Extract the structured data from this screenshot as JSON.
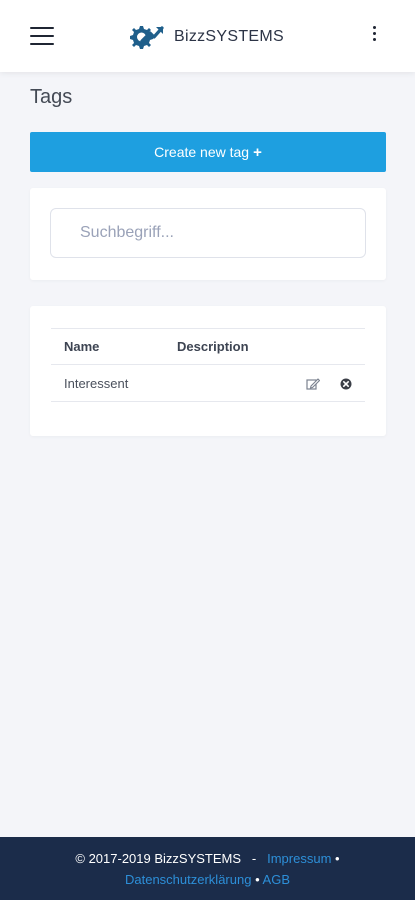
{
  "header": {
    "brand_name": "BizzSYSTEMS",
    "menu_icon": "hamburger-menu-icon",
    "more_icon": "more-vertical-icon",
    "logo_color": "#1f5f8b"
  },
  "page": {
    "title": "Tags",
    "create_button_label": "Create new tag",
    "create_button_icon": "+",
    "accent_color": "#1e9fe0"
  },
  "search": {
    "placeholder": "Suchbegriff...",
    "value": ""
  },
  "table": {
    "headers": [
      "Name",
      "Description"
    ],
    "rows": [
      {
        "name": "Interessent",
        "description": "",
        "actions": [
          "edit-icon",
          "delete-icon"
        ]
      }
    ]
  },
  "footer": {
    "copyright": "© 2017-2019 BizzSYSTEMS",
    "separator": "-",
    "links": [
      "Impressum",
      "Datenschutzerklärung",
      "AGB"
    ],
    "bullet": "•"
  }
}
